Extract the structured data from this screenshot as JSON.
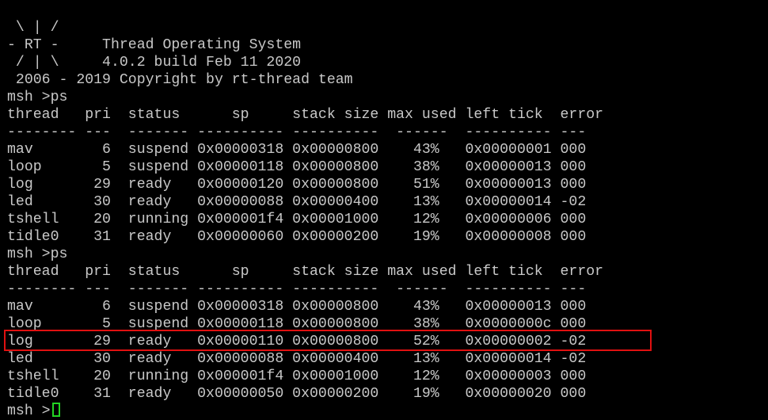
{
  "colors": {
    "background": "#000000",
    "text": "#c8c8c8",
    "cursor": "#22d422",
    "highlight": "#e01010"
  },
  "terminal": {
    "lines": [
      " \\ | /",
      "- RT -     Thread Operating System",
      " / | \\     4.0.2 build Feb 11 2020",
      " 2006 - 2019 Copyright by rt-thread team",
      "msh >ps",
      "thread   pri  status      sp     stack size max used left tick  error",
      "-------- ---  ------- ---------- ----------  ------  ---------- ---",
      "mav        6  suspend 0x00000318 0x00000800    43%   0x00000001 000",
      "loop       5  suspend 0x00000118 0x00000800    38%   0x00000013 000",
      "log       29  ready   0x00000120 0x00000800    51%   0x00000013 000",
      "led       30  ready   0x00000088 0x00000400    13%   0x00000014 -02",
      "tshell    20  running 0x000001f4 0x00001000    12%   0x00000006 000",
      "tidle0    31  ready   0x00000060 0x00000200    19%   0x00000008 000",
      "msh >ps",
      "thread   pri  status      sp     stack size max used left tick  error",
      "-------- ---  ------- ---------- ----------  ------  ---------- ---",
      "mav        6  suspend 0x00000318 0x00000800    43%   0x00000013 000",
      "loop       5  suspend 0x00000118 0x00000800    38%   0x0000000c 000",
      "log       29  ready   0x00000110 0x00000800    52%   0x00000002 -02",
      "led       30  ready   0x00000088 0x00000400    13%   0x00000014 -02",
      "tshell    20  running 0x000001f4 0x00001000    12%   0x00000003 000",
      "tidle0    31  ready   0x00000050 0x00000200    19%   0x00000020 000"
    ],
    "prompt": "msh >"
  }
}
